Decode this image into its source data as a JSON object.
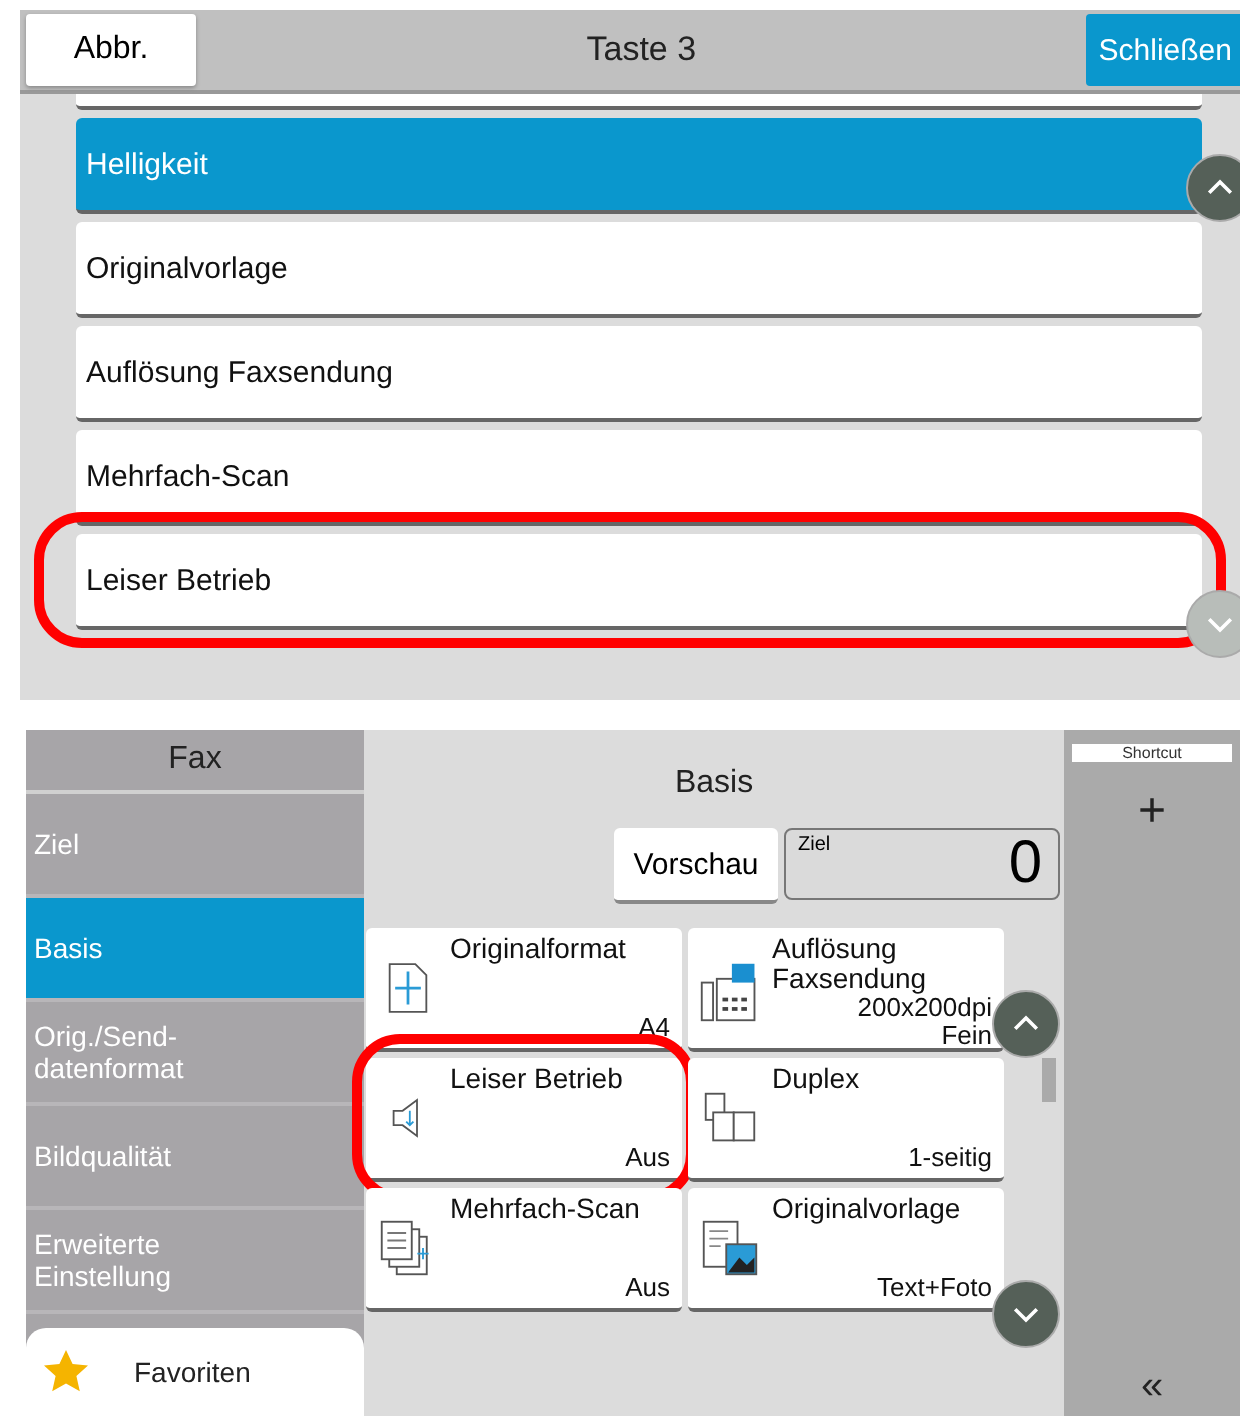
{
  "settings_dialog": {
    "cancel_button": "Abbr.",
    "title": "Taste 3",
    "close_button": "Schließen",
    "items": [
      {
        "label": "Helligkeit",
        "selected": true,
        "highlighted": false
      },
      {
        "label": "Originalvorlage",
        "selected": false,
        "highlighted": false
      },
      {
        "label": "Auflösung Faxsendung",
        "selected": false,
        "highlighted": false
      },
      {
        "label": "Mehrfach-Scan",
        "selected": false,
        "highlighted": false
      },
      {
        "label": "Leiser Betrieb",
        "selected": false,
        "highlighted": true
      }
    ]
  },
  "fax_screen": {
    "sidebar": {
      "title": "Fax",
      "items": [
        {
          "label": "Ziel",
          "selected": false
        },
        {
          "label": "Basis",
          "selected": true
        },
        {
          "label": "Orig./Send-datenformat",
          "selected": false
        },
        {
          "label": "Bildqualität",
          "selected": false
        },
        {
          "label": "Erweiterte Einstellung",
          "selected": false
        }
      ],
      "favorites": "Favoriten"
    },
    "main": {
      "title": "Basis",
      "preview_button": "Vorschau",
      "destination": {
        "label": "Ziel",
        "count": "0"
      },
      "tiles": [
        {
          "kind": "original-size",
          "label": "Originalformat",
          "values": [
            "A4"
          ],
          "highlighted": false
        },
        {
          "kind": "fax-resolution",
          "label": "Auflösung Faxsendung",
          "values": [
            "200x200dpi",
            "Fein"
          ],
          "highlighted": false
        },
        {
          "kind": "quiet-mode",
          "label": "Leiser Betrieb",
          "values": [
            "Aus"
          ],
          "highlighted": true
        },
        {
          "kind": "duplex",
          "label": "Duplex",
          "values": [
            "1-seitig"
          ],
          "highlighted": false
        },
        {
          "kind": "multi-scan",
          "label": "Mehrfach-Scan",
          "values": [
            "Aus"
          ],
          "highlighted": false
        },
        {
          "kind": "original-type",
          "label": "Originalvorlage",
          "values": [
            "Text+Foto"
          ],
          "highlighted": false
        }
      ]
    },
    "shortcut_panel": {
      "tab": "Shortcut",
      "add_button": "+",
      "collapse_button": "«"
    }
  }
}
